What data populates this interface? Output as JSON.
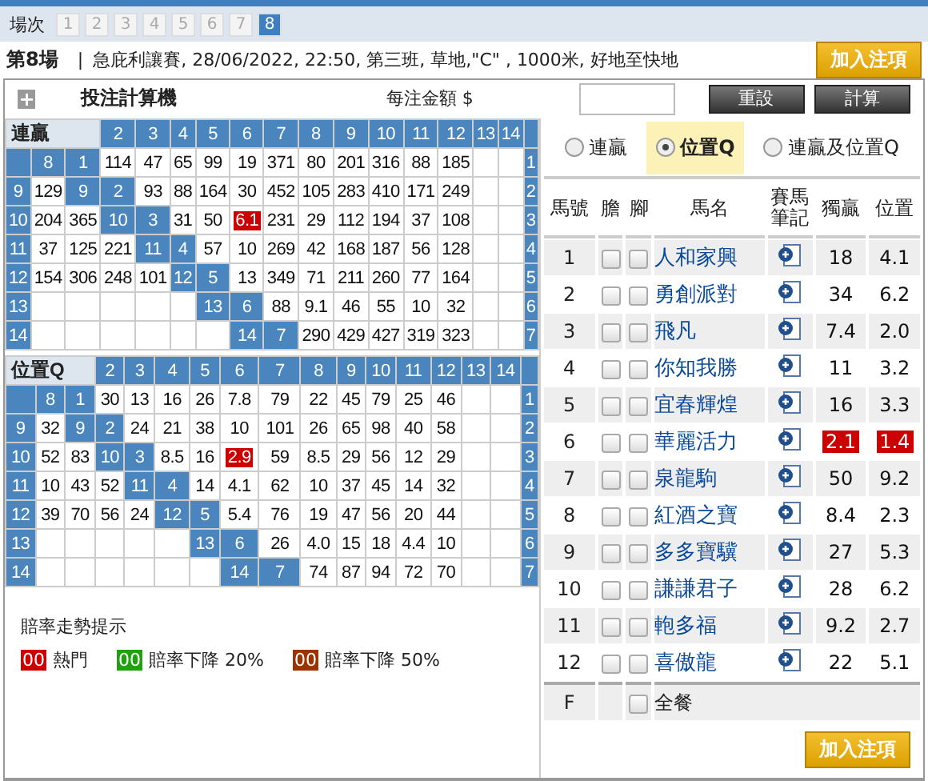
{
  "races": {
    "label": "場次",
    "items": [
      {
        "text": "1",
        "selected": false
      },
      {
        "text": "2",
        "selected": false
      },
      {
        "text": "3",
        "selected": false
      },
      {
        "text": "4",
        "selected": false
      },
      {
        "text": "5",
        "selected": false
      },
      {
        "text": "6",
        "selected": false
      },
      {
        "text": "7",
        "selected": false
      },
      {
        "text": "8",
        "selected": true
      }
    ]
  },
  "race_info": {
    "race": "第8場",
    "separator": "|",
    "details": "急庇利讓賽, 28/06/2022, 22:50, 第三班, 草地,\"C\" , 1000米, 好地至快地",
    "button": "加入注項"
  },
  "calculator": {
    "expand": "+",
    "title": "投注計算機",
    "amount_label": "每注金額 $",
    "reset": "重設",
    "calculate": "計算"
  },
  "grids": [
    {
      "title": "連贏",
      "header": [
        {
          "kind": "head",
          "text": "2"
        },
        {
          "kind": "head",
          "text": "3"
        },
        {
          "kind": "head",
          "text": "4"
        },
        {
          "kind": "head",
          "text": "5"
        },
        {
          "kind": "head",
          "text": "6"
        },
        {
          "kind": "head",
          "text": "7"
        },
        {
          "kind": "head",
          "text": "8"
        },
        {
          "kind": "head",
          "text": "9"
        },
        {
          "kind": "head",
          "text": "10"
        },
        {
          "kind": "head",
          "text": "11"
        },
        {
          "kind": "head",
          "text": "12"
        },
        {
          "kind": "head",
          "text": "13"
        },
        {
          "kind": "head",
          "text": "14"
        },
        {
          "kind": "head"
        }
      ],
      "rows": [
        [
          {
            "kind": "head"
          },
          {
            "kind": "head",
            "text": "8"
          },
          {
            "kind": "head",
            "text": "1"
          },
          {
            "kind": "odds",
            "text": "114"
          },
          {
            "kind": "odds",
            "text": "47"
          },
          {
            "kind": "odds",
            "text": "65"
          },
          {
            "kind": "odds",
            "text": "99"
          },
          {
            "kind": "odds",
            "text": "19"
          },
          {
            "kind": "odds",
            "text": "371"
          },
          {
            "kind": "odds",
            "text": "80"
          },
          {
            "kind": "odds",
            "text": "201"
          },
          {
            "kind": "odds",
            "text": "316"
          },
          {
            "kind": "odds",
            "text": "88"
          },
          {
            "kind": "odds",
            "text": "185"
          },
          {
            "kind": "blank"
          },
          {
            "kind": "blank"
          },
          {
            "kind": "head",
            "text": "1"
          }
        ],
        [
          {
            "kind": "head",
            "text": "9"
          },
          {
            "kind": "odds",
            "text": "129"
          },
          {
            "kind": "head",
            "text": "9"
          },
          {
            "kind": "head",
            "text": "2"
          },
          {
            "kind": "odds",
            "text": "93"
          },
          {
            "kind": "odds",
            "text": "88"
          },
          {
            "kind": "odds",
            "text": "164"
          },
          {
            "kind": "odds",
            "text": "30"
          },
          {
            "kind": "odds",
            "text": "452"
          },
          {
            "kind": "odds",
            "text": "105"
          },
          {
            "kind": "odds",
            "text": "283"
          },
          {
            "kind": "odds",
            "text": "410"
          },
          {
            "kind": "odds",
            "text": "171"
          },
          {
            "kind": "odds",
            "text": "249"
          },
          {
            "kind": "blank"
          },
          {
            "kind": "blank"
          },
          {
            "kind": "head",
            "text": "2"
          }
        ],
        [
          {
            "kind": "head",
            "text": "10"
          },
          {
            "kind": "odds",
            "text": "204"
          },
          {
            "kind": "odds",
            "text": "365"
          },
          {
            "kind": "head",
            "text": "10"
          },
          {
            "kind": "head",
            "text": "3"
          },
          {
            "kind": "odds",
            "text": "31"
          },
          {
            "kind": "odds",
            "text": "50"
          },
          {
            "kind": "hot",
            "text": "6.1"
          },
          {
            "kind": "odds",
            "text": "231"
          },
          {
            "kind": "odds",
            "text": "29"
          },
          {
            "kind": "odds",
            "text": "112"
          },
          {
            "kind": "odds",
            "text": "194"
          },
          {
            "kind": "odds",
            "text": "37"
          },
          {
            "kind": "odds",
            "text": "108"
          },
          {
            "kind": "blank"
          },
          {
            "kind": "blank"
          },
          {
            "kind": "head",
            "text": "3"
          }
        ],
        [
          {
            "kind": "head",
            "text": "11"
          },
          {
            "kind": "odds",
            "text": "37"
          },
          {
            "kind": "odds",
            "text": "125"
          },
          {
            "kind": "odds",
            "text": "221"
          },
          {
            "kind": "head",
            "text": "11"
          },
          {
            "kind": "head",
            "text": "4"
          },
          {
            "kind": "odds",
            "text": "57"
          },
          {
            "kind": "odds",
            "text": "10"
          },
          {
            "kind": "odds",
            "text": "269"
          },
          {
            "kind": "odds",
            "text": "42"
          },
          {
            "kind": "odds",
            "text": "168"
          },
          {
            "kind": "odds",
            "text": "187"
          },
          {
            "kind": "odds",
            "text": "56"
          },
          {
            "kind": "odds",
            "text": "128"
          },
          {
            "kind": "blank"
          },
          {
            "kind": "blank"
          },
          {
            "kind": "head",
            "text": "4"
          }
        ],
        [
          {
            "kind": "head",
            "text": "12"
          },
          {
            "kind": "odds",
            "text": "154"
          },
          {
            "kind": "odds",
            "text": "306"
          },
          {
            "kind": "odds",
            "text": "248"
          },
          {
            "kind": "odds",
            "text": "101"
          },
          {
            "kind": "head",
            "text": "12"
          },
          {
            "kind": "head",
            "text": "5"
          },
          {
            "kind": "odds",
            "text": "13"
          },
          {
            "kind": "odds",
            "text": "349"
          },
          {
            "kind": "odds",
            "text": "71"
          },
          {
            "kind": "odds",
            "text": "211"
          },
          {
            "kind": "odds",
            "text": "260"
          },
          {
            "kind": "odds",
            "text": "77"
          },
          {
            "kind": "odds",
            "text": "164"
          },
          {
            "kind": "blank"
          },
          {
            "kind": "blank"
          },
          {
            "kind": "head",
            "text": "5"
          }
        ],
        [
          {
            "kind": "head",
            "text": "13"
          },
          {
            "kind": "blank"
          },
          {
            "kind": "blank"
          },
          {
            "kind": "blank"
          },
          {
            "kind": "blank"
          },
          {
            "kind": "blank"
          },
          {
            "kind": "head",
            "text": "13"
          },
          {
            "kind": "head",
            "text": "6"
          },
          {
            "kind": "odds",
            "text": "88"
          },
          {
            "kind": "odds",
            "text": "9.1"
          },
          {
            "kind": "odds",
            "text": "46"
          },
          {
            "kind": "odds",
            "text": "55"
          },
          {
            "kind": "odds",
            "text": "10"
          },
          {
            "kind": "odds",
            "text": "32"
          },
          {
            "kind": "blank"
          },
          {
            "kind": "blank"
          },
          {
            "kind": "head",
            "text": "6"
          }
        ],
        [
          {
            "kind": "head",
            "text": "14"
          },
          {
            "kind": "blank"
          },
          {
            "kind": "blank"
          },
          {
            "kind": "blank"
          },
          {
            "kind": "blank"
          },
          {
            "kind": "blank"
          },
          {
            "kind": "blank"
          },
          {
            "kind": "head",
            "text": "14"
          },
          {
            "kind": "head",
            "text": "7"
          },
          {
            "kind": "odds",
            "text": "290"
          },
          {
            "kind": "odds",
            "text": "429"
          },
          {
            "kind": "odds",
            "text": "427"
          },
          {
            "kind": "odds",
            "text": "319"
          },
          {
            "kind": "odds",
            "text": "323"
          },
          {
            "kind": "blank"
          },
          {
            "kind": "blank"
          },
          {
            "kind": "head",
            "text": "7"
          }
        ]
      ]
    },
    {
      "title": "位置Q",
      "header": [
        {
          "kind": "head",
          "text": "2"
        },
        {
          "kind": "head",
          "text": "3"
        },
        {
          "kind": "head",
          "text": "4"
        },
        {
          "kind": "head",
          "text": "5"
        },
        {
          "kind": "head",
          "text": "6"
        },
        {
          "kind": "head",
          "text": "7"
        },
        {
          "kind": "head",
          "text": "8"
        },
        {
          "kind": "head",
          "text": "9"
        },
        {
          "kind": "head",
          "text": "10"
        },
        {
          "kind": "head",
          "text": "11"
        },
        {
          "kind": "head",
          "text": "12"
        },
        {
          "kind": "head",
          "text": "13"
        },
        {
          "kind": "head",
          "text": "14"
        },
        {
          "kind": "head"
        }
      ],
      "rows": [
        [
          {
            "kind": "head"
          },
          {
            "kind": "head",
            "text": "8"
          },
          {
            "kind": "head",
            "text": "1"
          },
          {
            "kind": "odds",
            "text": "30"
          },
          {
            "kind": "odds",
            "text": "13"
          },
          {
            "kind": "odds",
            "text": "16"
          },
          {
            "kind": "odds",
            "text": "26"
          },
          {
            "kind": "odds",
            "text": "7.8"
          },
          {
            "kind": "odds",
            "text": "79"
          },
          {
            "kind": "odds",
            "text": "22"
          },
          {
            "kind": "odds",
            "text": "45"
          },
          {
            "kind": "odds",
            "text": "79"
          },
          {
            "kind": "odds",
            "text": "25"
          },
          {
            "kind": "odds",
            "text": "46"
          },
          {
            "kind": "blank"
          },
          {
            "kind": "blank"
          },
          {
            "kind": "head",
            "text": "1"
          }
        ],
        [
          {
            "kind": "head",
            "text": "9"
          },
          {
            "kind": "odds",
            "text": "32"
          },
          {
            "kind": "head",
            "text": "9"
          },
          {
            "kind": "head",
            "text": "2"
          },
          {
            "kind": "odds",
            "text": "24"
          },
          {
            "kind": "odds",
            "text": "21"
          },
          {
            "kind": "odds",
            "text": "38"
          },
          {
            "kind": "odds",
            "text": "10"
          },
          {
            "kind": "odds",
            "text": "101"
          },
          {
            "kind": "odds",
            "text": "26"
          },
          {
            "kind": "odds",
            "text": "65"
          },
          {
            "kind": "odds",
            "text": "98"
          },
          {
            "kind": "odds",
            "text": "40"
          },
          {
            "kind": "odds",
            "text": "58"
          },
          {
            "kind": "blank"
          },
          {
            "kind": "blank"
          },
          {
            "kind": "head",
            "text": "2"
          }
        ],
        [
          {
            "kind": "head",
            "text": "10"
          },
          {
            "kind": "odds",
            "text": "52"
          },
          {
            "kind": "odds",
            "text": "83"
          },
          {
            "kind": "head",
            "text": "10"
          },
          {
            "kind": "head",
            "text": "3"
          },
          {
            "kind": "odds",
            "text": "8.5"
          },
          {
            "kind": "odds",
            "text": "16"
          },
          {
            "kind": "hot",
            "text": "2.9"
          },
          {
            "kind": "odds",
            "text": "59"
          },
          {
            "kind": "odds",
            "text": "8.5"
          },
          {
            "kind": "odds",
            "text": "29"
          },
          {
            "kind": "odds",
            "text": "56"
          },
          {
            "kind": "odds",
            "text": "12"
          },
          {
            "kind": "odds",
            "text": "29"
          },
          {
            "kind": "blank"
          },
          {
            "kind": "blank"
          },
          {
            "kind": "head",
            "text": "3"
          }
        ],
        [
          {
            "kind": "head",
            "text": "11"
          },
          {
            "kind": "odds",
            "text": "10"
          },
          {
            "kind": "odds",
            "text": "43"
          },
          {
            "kind": "odds",
            "text": "52"
          },
          {
            "kind": "head",
            "text": "11"
          },
          {
            "kind": "head",
            "text": "4"
          },
          {
            "kind": "odds",
            "text": "14"
          },
          {
            "kind": "odds",
            "text": "4.1"
          },
          {
            "kind": "odds",
            "text": "62"
          },
          {
            "kind": "odds",
            "text": "10"
          },
          {
            "kind": "odds",
            "text": "37"
          },
          {
            "kind": "odds",
            "text": "45"
          },
          {
            "kind": "odds",
            "text": "14"
          },
          {
            "kind": "odds",
            "text": "32"
          },
          {
            "kind": "blank"
          },
          {
            "kind": "blank"
          },
          {
            "kind": "head",
            "text": "4"
          }
        ],
        [
          {
            "kind": "head",
            "text": "12"
          },
          {
            "kind": "odds",
            "text": "39"
          },
          {
            "kind": "odds",
            "text": "70"
          },
          {
            "kind": "odds",
            "text": "56"
          },
          {
            "kind": "odds",
            "text": "24"
          },
          {
            "kind": "head",
            "text": "12"
          },
          {
            "kind": "head",
            "text": "5"
          },
          {
            "kind": "odds",
            "text": "5.4"
          },
          {
            "kind": "odds",
            "text": "76"
          },
          {
            "kind": "odds",
            "text": "19"
          },
          {
            "kind": "odds",
            "text": "47"
          },
          {
            "kind": "odds",
            "text": "56"
          },
          {
            "kind": "odds",
            "text": "20"
          },
          {
            "kind": "odds",
            "text": "44"
          },
          {
            "kind": "blank"
          },
          {
            "kind": "blank"
          },
          {
            "kind": "head",
            "text": "5"
          }
        ],
        [
          {
            "kind": "head",
            "text": "13"
          },
          {
            "kind": "blank"
          },
          {
            "kind": "blank"
          },
          {
            "kind": "blank"
          },
          {
            "kind": "blank"
          },
          {
            "kind": "blank"
          },
          {
            "kind": "head",
            "text": "13"
          },
          {
            "kind": "head",
            "text": "6"
          },
          {
            "kind": "odds",
            "text": "26"
          },
          {
            "kind": "odds",
            "text": "4.0"
          },
          {
            "kind": "odds",
            "text": "15"
          },
          {
            "kind": "odds",
            "text": "18"
          },
          {
            "kind": "odds",
            "text": "4.4"
          },
          {
            "kind": "odds",
            "text": "10"
          },
          {
            "kind": "blank"
          },
          {
            "kind": "blank"
          },
          {
            "kind": "head",
            "text": "6"
          }
        ],
        [
          {
            "kind": "head",
            "text": "14"
          },
          {
            "kind": "blank"
          },
          {
            "kind": "blank"
          },
          {
            "kind": "blank"
          },
          {
            "kind": "blank"
          },
          {
            "kind": "blank"
          },
          {
            "kind": "blank"
          },
          {
            "kind": "head",
            "text": "14"
          },
          {
            "kind": "head",
            "text": "7"
          },
          {
            "kind": "odds",
            "text": "74"
          },
          {
            "kind": "odds",
            "text": "87"
          },
          {
            "kind": "odds",
            "text": "94"
          },
          {
            "kind": "odds",
            "text": "72"
          },
          {
            "kind": "odds",
            "text": "70"
          },
          {
            "kind": "blank"
          },
          {
            "kind": "blank"
          },
          {
            "kind": "head",
            "text": "7"
          }
        ]
      ]
    }
  ],
  "legend": {
    "title": "賠率走勢提示",
    "items": [
      {
        "sample": "00",
        "label": "熱門",
        "color": "#cc0000"
      },
      {
        "sample": "00",
        "label": "賠率下降 20%",
        "color": "#22a011"
      },
      {
        "sample": "00",
        "label": "賠率下降 50%",
        "color": "#993300"
      }
    ]
  },
  "bet_types": [
    {
      "label": "連贏",
      "selected": false
    },
    {
      "label": "位置Q",
      "selected": true
    },
    {
      "label": "連贏及位置Q",
      "selected": false
    }
  ],
  "table": {
    "columns": [
      "馬號",
      "膽",
      "腳",
      "馬名",
      "賽馬筆記",
      "獨贏",
      "位置"
    ],
    "rows": [
      {
        "no": "1",
        "banker": false,
        "leg": false,
        "name": "人和家興",
        "win": "18",
        "place": "4.1",
        "hot": false
      },
      {
        "no": "2",
        "banker": false,
        "leg": false,
        "name": "勇創派對",
        "win": "34",
        "place": "6.2",
        "hot": false
      },
      {
        "no": "3",
        "banker": false,
        "leg": false,
        "name": "飛凡",
        "win": "7.4",
        "place": "2.0",
        "hot": false
      },
      {
        "no": "4",
        "banker": false,
        "leg": false,
        "name": "你知我勝",
        "win": "11",
        "place": "3.2",
        "hot": false
      },
      {
        "no": "5",
        "banker": false,
        "leg": false,
        "name": "宜春輝煌",
        "win": "16",
        "place": "3.3",
        "hot": false
      },
      {
        "no": "6",
        "banker": false,
        "leg": false,
        "name": "華麗活力",
        "win": "2.1",
        "place": "1.4",
        "hot": true
      },
      {
        "no": "7",
        "banker": false,
        "leg": false,
        "name": "泉龍駒",
        "win": "50",
        "place": "9.2",
        "hot": false
      },
      {
        "no": "8",
        "banker": false,
        "leg": false,
        "name": "紅酒之寶",
        "win": "8.4",
        "place": "2.3",
        "hot": false
      },
      {
        "no": "9",
        "banker": false,
        "leg": false,
        "name": "多多寶驥",
        "win": "27",
        "place": "5.3",
        "hot": false
      },
      {
        "no": "10",
        "banker": false,
        "leg": false,
        "name": "謙謙君子",
        "win": "28",
        "place": "6.2",
        "hot": false
      },
      {
        "no": "11",
        "banker": false,
        "leg": false,
        "name": "軳多福",
        "win": "9.2",
        "place": "2.7",
        "hot": false
      },
      {
        "no": "12",
        "banker": false,
        "leg": false,
        "name": "喜傲龍",
        "win": "22",
        "place": "5.1",
        "hot": false
      }
    ],
    "field": {
      "no": "F",
      "leg": false,
      "label": "全餐"
    }
  },
  "add_button": "加入注項"
}
